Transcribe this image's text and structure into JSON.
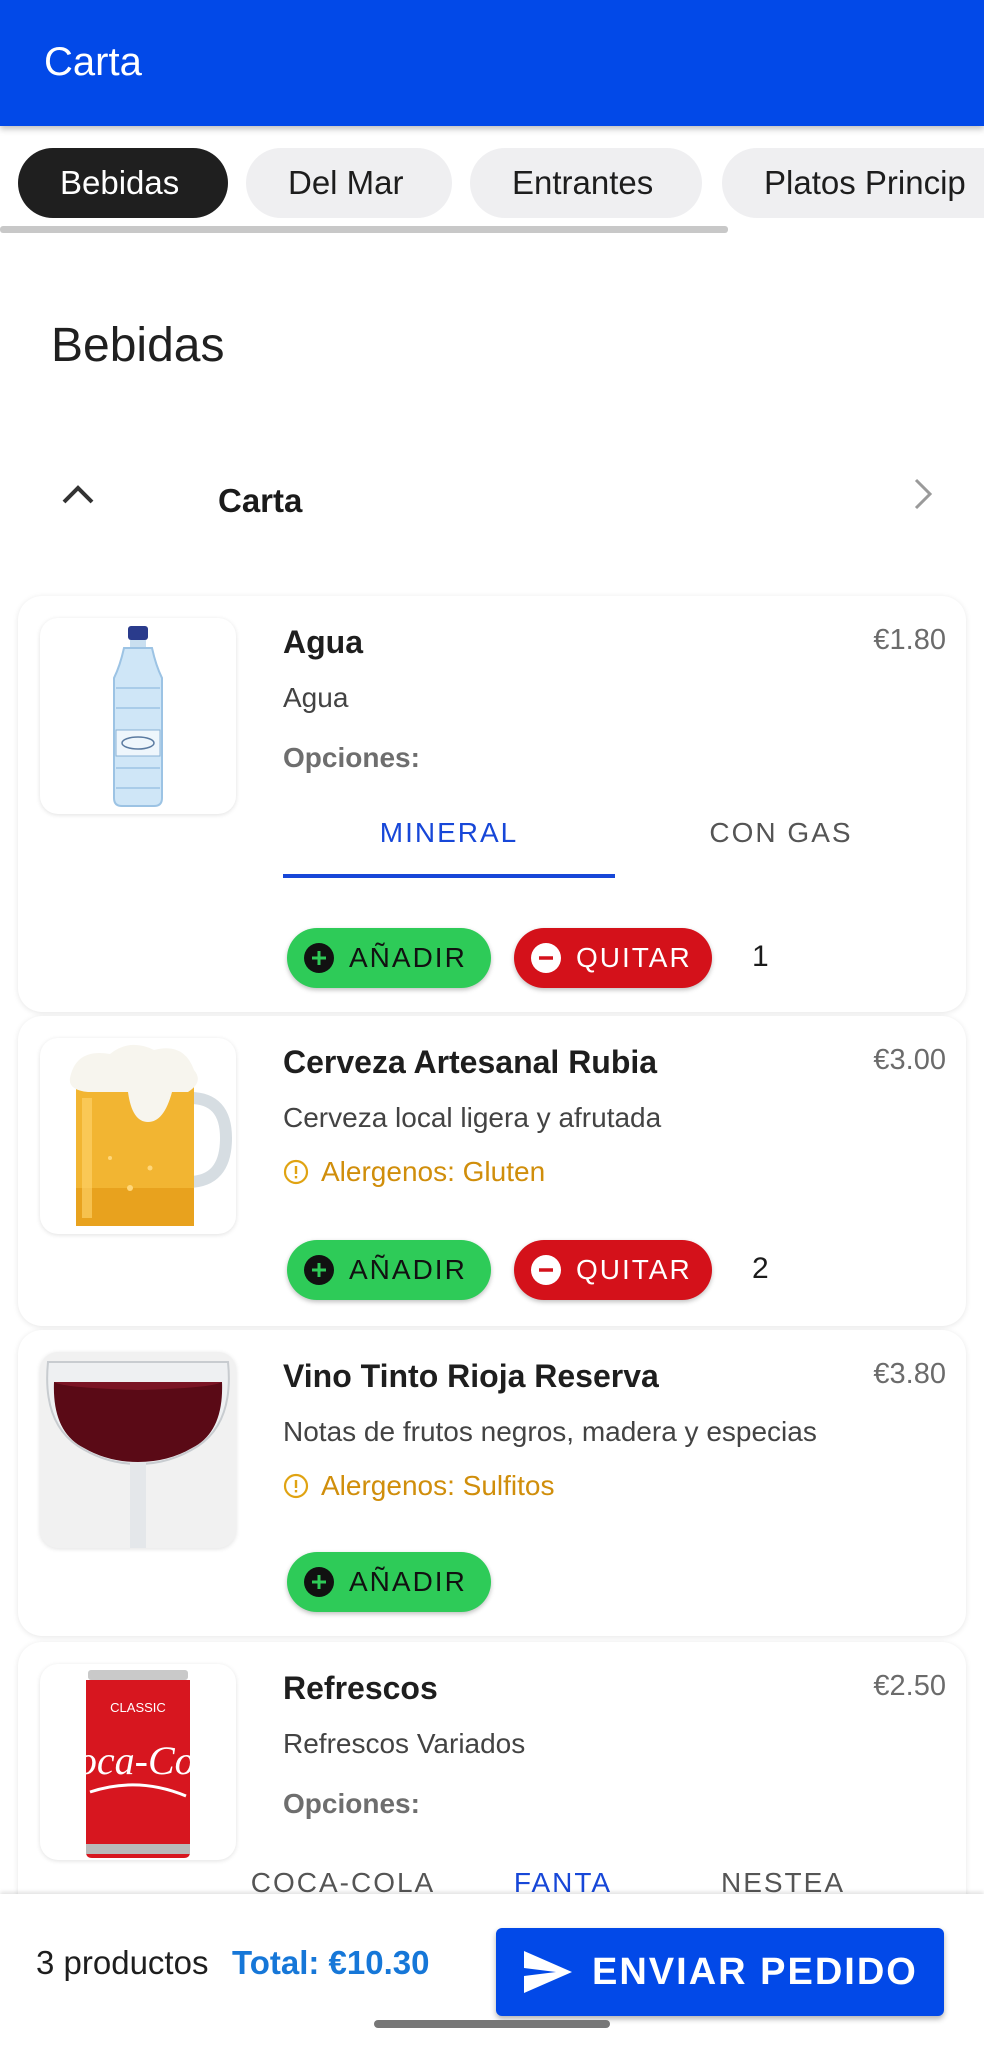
{
  "appbar": {
    "title": "Carta"
  },
  "categories": [
    {
      "label": "Bebidas",
      "active": true
    },
    {
      "label": "Del Mar",
      "active": false
    },
    {
      "label": "Entrantes",
      "active": false
    },
    {
      "label": "Platos Princip",
      "active": false
    }
  ],
  "section": {
    "title": "Bebidas"
  },
  "cart_row": {
    "label": "Carta"
  },
  "products": [
    {
      "name": "Agua",
      "price": "€1.80",
      "description": "Agua",
      "options_label": "Opciones:",
      "options": [
        "MINERAL",
        "CON GAS"
      ],
      "selected_option": "MINERAL",
      "add_label": "AÑADIR",
      "remove_label": "QUITAR",
      "quantity": "1",
      "image": "water-bottle"
    },
    {
      "name": "Cerveza Artesanal Rubia",
      "price": "€3.00",
      "description": "Cerveza local ligera y afrutada",
      "allergens": "Alergenos: Gluten",
      "add_label": "AÑADIR",
      "remove_label": "QUITAR",
      "quantity": "2",
      "image": "beer-mug"
    },
    {
      "name": "Vino Tinto Rioja Reserva",
      "price": "€3.80",
      "description": "Notas de frutos negros, madera y especias",
      "allergens": "Alergenos: Sulfitos",
      "add_label": "AÑADIR",
      "image": "wine-glass"
    },
    {
      "name": "Refrescos",
      "price": "€2.50",
      "description": "Refrescos Variados",
      "options_label": "Opciones:",
      "options": [
        "COCA-COLA",
        "FANTA",
        "NESTEA"
      ],
      "selected_option": "FANTA",
      "image": "soda-can",
      "can_top_text": "CLASSIC",
      "can_brand": "Coca-Cola"
    }
  ],
  "footer": {
    "count": "3 productos",
    "total": "Total: €10.30",
    "send_label": "ENVIAR PEDIDO"
  },
  "colors": {
    "primary": "#0249e8",
    "add_green": "#2ecb58",
    "remove_red": "#d4111a",
    "allergen": "#d08e0b",
    "total_blue": "#1677d8",
    "option_selected": "#1747d8"
  }
}
